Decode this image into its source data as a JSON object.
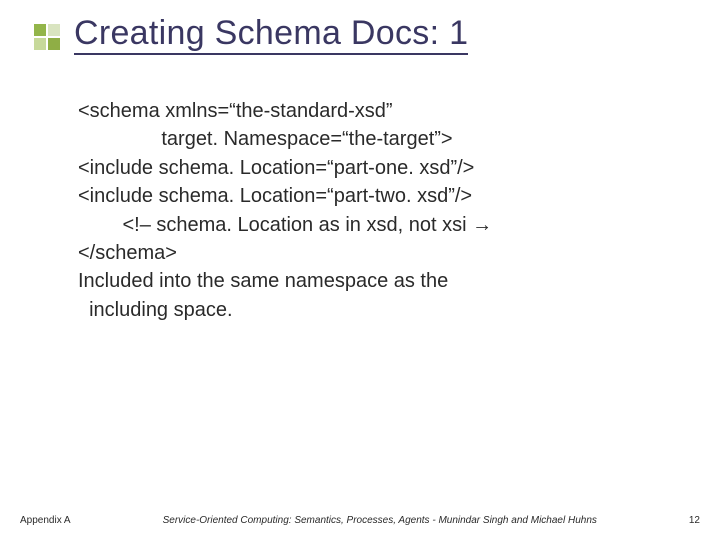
{
  "title": "Creating Schema Docs: 1",
  "lines": [
    "<schema xmlns=“the-standard-xsd”",
    "               target. Namespace=“the-target”>",
    "<include schema. Location=“part-one. xsd”/>",
    "<include schema. Location=“part-two. xsd”/>",
    "        <!– schema. Location as in xsd, not xsi →",
    "</schema>",
    "Included into the same namespace as the",
    "  including space."
  ],
  "footer": {
    "left": "Appendix A",
    "center": "Service-Oriented Computing: Semantics, Processes, Agents - Munindar Singh and Michael Huhns",
    "right": "12"
  }
}
